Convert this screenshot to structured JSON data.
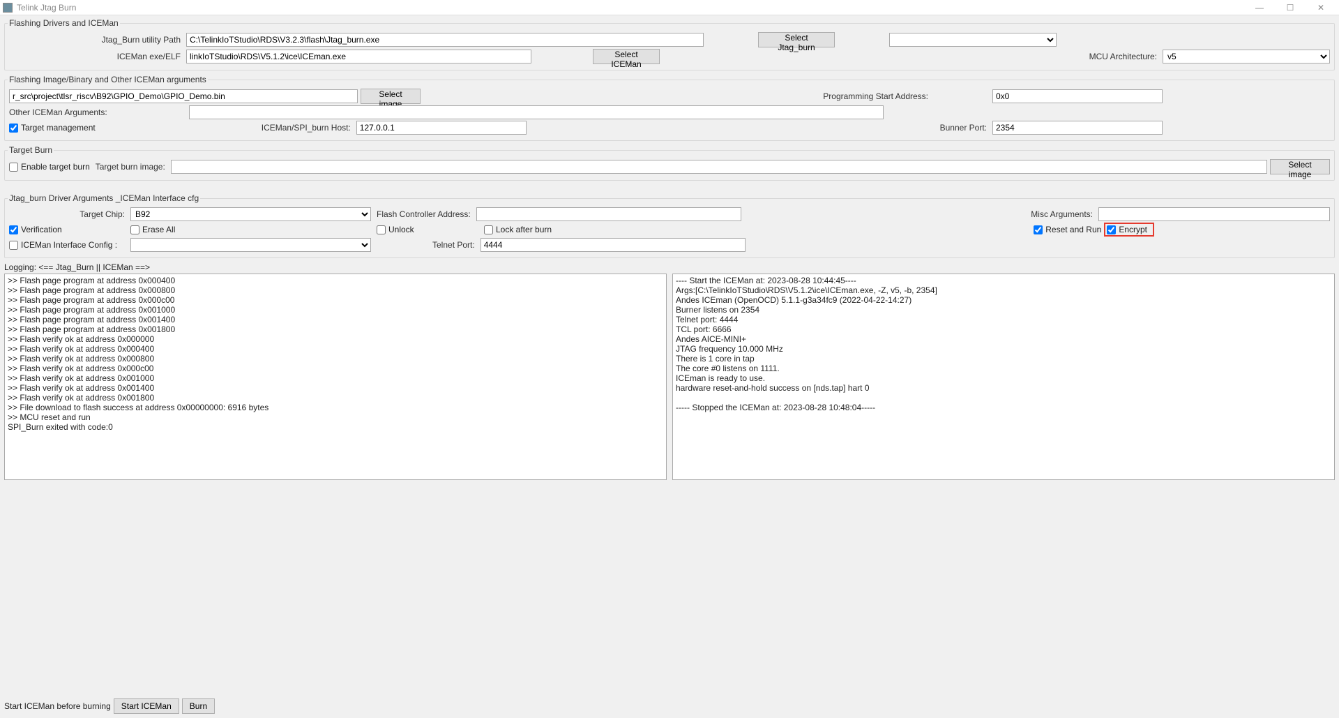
{
  "window": {
    "title": "Telink Jtag Burn"
  },
  "group1": {
    "legend": "Flashing Drivers and ICEMan",
    "jtag_path_label": "Jtag_Burn utility Path",
    "jtag_path_value": "C:\\TelinkIoTStudio\\RDS\\V3.2.3\\flash\\Jtag_burn.exe",
    "select_jtag_btn": "Select Jtag_burn",
    "iceman_label": "ICEMan exe/ELF",
    "iceman_value": "linkIoTStudio\\RDS\\V5.1.2\\ice\\ICEman.exe",
    "select_iceman_btn": "Select ICEMan",
    "mcu_arch_label": "MCU Architecture:",
    "mcu_arch_value": "v5"
  },
  "group2": {
    "legend": "Flashing Image/Binary and Other ICEMan arguments",
    "image_value": "r_src\\project\\tlsr_riscv\\B92\\GPIO_Demo\\GPIO_Demo.bin",
    "select_image_btn": "Select image",
    "prog_addr_label": "Programming Start Address:",
    "prog_addr_value": "0x0",
    "other_args_label": "Other ICEMan Arguments:",
    "other_args_value": "",
    "target_mgmt_label": "Target management",
    "host_label": "ICEMan/SPI_burn Host:",
    "host_value": "127.0.0.1",
    "port_label": "Bunner Port:",
    "port_value": "2354"
  },
  "group3": {
    "legend": "Target Burn",
    "enable_label": "Enable target burn",
    "target_image_label": "Target burn image:",
    "target_image_value": "",
    "select_image_btn": "Select image"
  },
  "group4": {
    "legend": "Jtag_burn Driver Arguments _ICEMan Interface cfg",
    "target_chip_label": "Target Chip:",
    "target_chip_value": "B92",
    "flash_ctrl_label": "Flash Controller Address:",
    "flash_ctrl_value": "",
    "misc_args_label": "Misc Arguments:",
    "misc_args_value": "",
    "verification_label": "Verification",
    "erase_all_label": "Erase All",
    "unlock_label": "Unlock",
    "lock_after_label": "Lock after burn",
    "reset_run_label": "Reset and Run",
    "encrypt_label": "Encrypt",
    "iceman_cfg_label": "ICEMan Interface Config :",
    "iceman_cfg_value": "",
    "telnet_label": "Telnet Port:",
    "telnet_value": "4444"
  },
  "logging": {
    "header": "Logging: <== Jtag_Burn || ICEMan ==>",
    "left": ">> Flash page program at address 0x000400\n>> Flash page program at address 0x000800\n>> Flash page program at address 0x000c00\n>> Flash page program at address 0x001000\n>> Flash page program at address 0x001400\n>> Flash page program at address 0x001800\n>> Flash verify ok at address 0x000000\n>> Flash verify ok at address 0x000400\n>> Flash verify ok at address 0x000800\n>> Flash verify ok at address 0x000c00\n>> Flash verify ok at address 0x001000\n>> Flash verify ok at address 0x001400\n>> Flash verify ok at address 0x001800\n>> File download to flash success at address 0x00000000: 6916 bytes\n>> MCU reset and run\nSPI_Burn exited with code:0",
    "right": "---- Start the ICEMan at: 2023-08-28 10:44:45----\nArgs:[C:\\TelinkIoTStudio\\RDS\\V5.1.2\\ice\\ICEman.exe, -Z, v5, -b, 2354]\nAndes ICEman (OpenOCD) 5.1.1-g3a34fc9 (2022-04-22-14:27)\nBurner listens on 2354\nTelnet port: 4444\nTCL port: 6666\nAndes AICE-MINI+\nJTAG frequency 10.000 MHz\nThere is 1 core in tap\nThe core #0 listens on 1111.\nICEman is ready to use.\nhardware reset-and-hold success on [nds.tap] hart 0\n\n----- Stopped the ICEMan at: 2023-08-28 10:48:04-----"
  },
  "footer": {
    "prefix": "Start ICEMan before burning",
    "start_btn": "Start ICEMan",
    "burn_btn": "Burn"
  }
}
